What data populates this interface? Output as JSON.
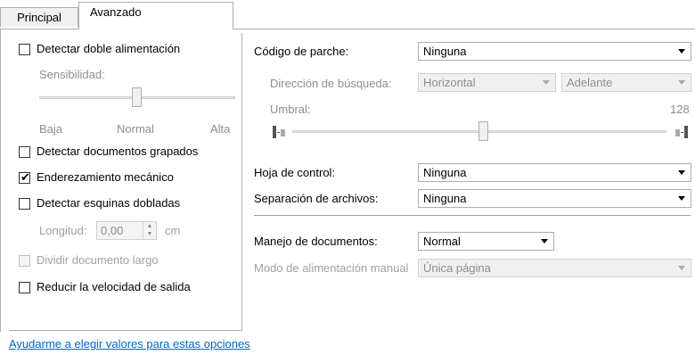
{
  "tabs": [
    {
      "label": "Principal"
    },
    {
      "label": "Avanzado"
    }
  ],
  "left": {
    "double_feed": {
      "label": "Detectar doble alimentación",
      "checked": false
    },
    "sensitivity": {
      "label": "Sensibilidad:",
      "low": "Baja",
      "mid": "Normal",
      "high": "Alta",
      "level_fraction": 0.5
    },
    "stapled": {
      "label": "Detectar documentos grapados",
      "checked": false
    },
    "deskew": {
      "label": "Enderezamiento mecánico",
      "checked": true
    },
    "dogear": {
      "label": "Detectar esquinas dobladas",
      "checked": false
    },
    "length": {
      "label": "Longitud:",
      "value": "0,00",
      "unit": "cm"
    },
    "split_long": {
      "label": "Dividir documento largo",
      "checked": false
    },
    "slow_output": {
      "label": "Reducir la velocidad de salida",
      "checked": false
    }
  },
  "right": {
    "patch_code": {
      "label": "Código de parche:",
      "value": "Ninguna"
    },
    "search_direction": {
      "label": "Dirección de búsqueda:",
      "value1": "Horizontal",
      "value2": "Adelante"
    },
    "threshold": {
      "label": "Umbral:",
      "value": "128",
      "level_fraction": 0.5
    },
    "control_sheet": {
      "label": "Hoja de control:",
      "value": "Ninguna"
    },
    "file_separation": {
      "label": "Separación de archivos:",
      "value": "Ninguna"
    },
    "doc_handling": {
      "label": "Manejo de documentos:",
      "value": "Normal"
    },
    "manual_feed": {
      "label": "Modo de alimentación manual",
      "value": "Única página"
    }
  },
  "help_link": "Ayudarme a elegir valores para estas opciones",
  "icons": {
    "check": "✔",
    "spin_up": "▲",
    "spin_down": "▼"
  }
}
